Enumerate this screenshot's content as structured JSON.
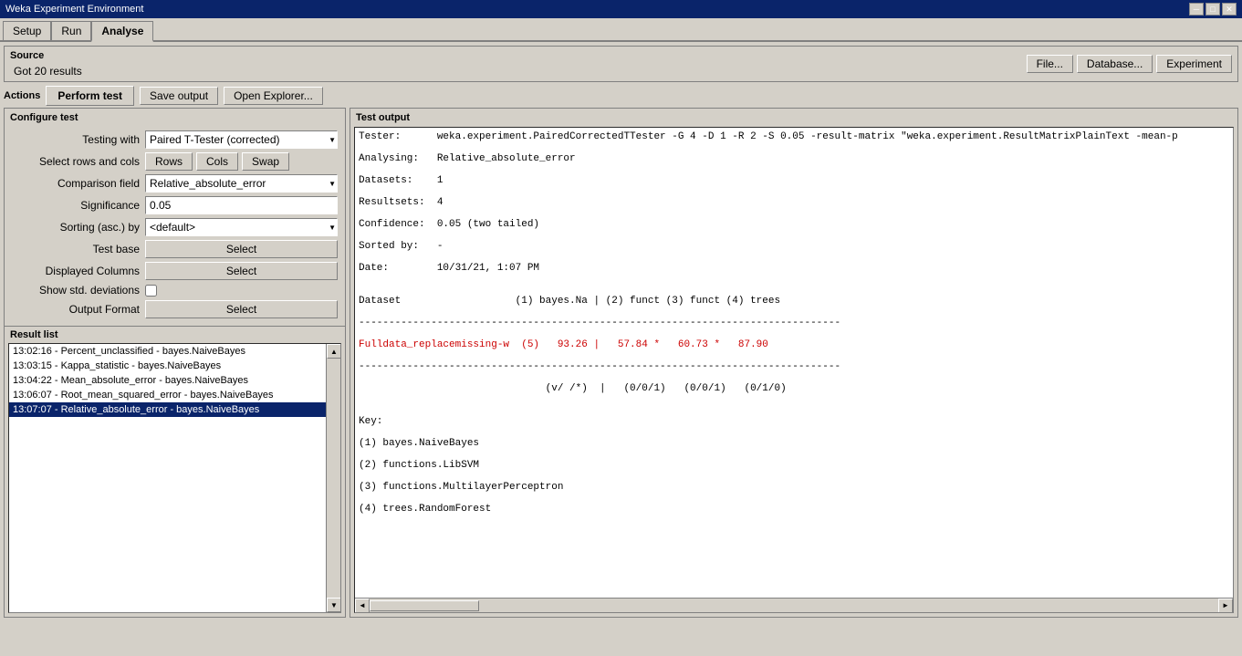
{
  "window": {
    "title": "Weka Experiment Environment"
  },
  "tabs": {
    "items": [
      {
        "label": "Setup",
        "active": false
      },
      {
        "label": "Run",
        "active": false
      },
      {
        "label": "Analyse",
        "active": true
      }
    ]
  },
  "source": {
    "label": "Source",
    "status": "Got 20 results",
    "buttons": {
      "file": "File...",
      "database": "Database...",
      "experiment": "Experiment"
    }
  },
  "actions": {
    "label": "Actions",
    "perform_test": "Perform test",
    "save_output": "Save output",
    "open_explorer": "Open Explorer..."
  },
  "configure_test": {
    "label": "Configure test",
    "testing_with_label": "Testing with",
    "testing_with_value": "Paired T-Tester (corrected)",
    "select_rows_cols_label": "Select rows and cols",
    "rows_btn": "Rows",
    "cols_btn": "Cols",
    "swap_btn": "Swap",
    "comparison_field_label": "Comparison field",
    "comparison_field_value": "Relative_absolute_error",
    "significance_label": "Significance",
    "significance_value": "0.05",
    "sorting_label": "Sorting (asc.) by",
    "sorting_value": "<default>",
    "test_base_label": "Test base",
    "test_base_btn": "Select",
    "displayed_columns_label": "Displayed Columns",
    "displayed_columns_btn": "Select",
    "show_std_deviations_label": "Show std. deviations",
    "output_format_label": "Output Format",
    "output_format_btn": "Select"
  },
  "result_list": {
    "label": "Result list",
    "items": [
      {
        "text": "13:02:16 - Percent_unclassified - bayes.NaiveBayes",
        "selected": false
      },
      {
        "text": "13:03:15 - Kappa_statistic - bayes.NaiveBayes",
        "selected": false
      },
      {
        "text": "13:04:22 - Mean_absolute_error - bayes.NaiveBayes",
        "selected": false
      },
      {
        "text": "13:06:07 - Root_mean_squared_error - bayes.NaiveBayes",
        "selected": false
      },
      {
        "text": "13:07:07 - Relative_absolute_error - bayes.NaiveBayes",
        "selected": true
      }
    ]
  },
  "test_output": {
    "label": "Test output",
    "content": {
      "tester": "Tester:      weka.experiment.PairedCorrectedTTester -G 4 -D 1 -R 2 -S 0.05 -result-matrix \"weka.experiment.ResultMatrixPlainText -mean-p",
      "analysing": "Analysing:   Relative_absolute_error",
      "datasets": "Datasets:    1",
      "resultsets": "Resultsets:  4",
      "confidence": "Confidence:  0.05 (two tailed)",
      "sorted_by": "Sorted by:   -",
      "date": "Date:        10/31/21, 1:07 PM",
      "dataset_header": "Dataset                   (1) bayes.Na | (2) funct (3) funct (4) trees",
      "separator1": "--------------------------------------------------------------------------------",
      "data_row": "Fulldata_replacemissing-w  (5)   93.26 |   57.84 *   60.73 *   87.90",
      "separator2": "--------------------------------------------------------------------------------",
      "summary_row": "                               (v/ /*)  |   (0/0/1)   (0/0/1)   (0/1/0)",
      "key_header": "Key:",
      "key1": "(1) bayes.NaiveBayes",
      "key2": "(2) functions.LibSVM",
      "key3": "(3) functions.MultilayerPerceptron",
      "key4": "(4) trees.RandomForest"
    }
  },
  "icons": {
    "dropdown_arrow": "▼",
    "scroll_up": "▲",
    "scroll_down": "▼",
    "scroll_left": "◄",
    "scroll_right": "►"
  }
}
